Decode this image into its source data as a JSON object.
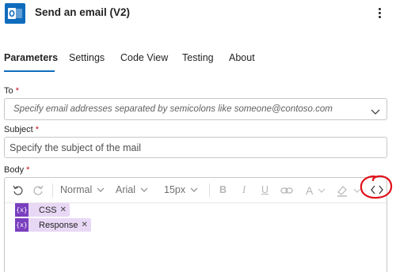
{
  "header": {
    "title": "Send an email (V2)",
    "app_icon": "outlook-icon",
    "more_icon": "more-vertical-icon"
  },
  "tabs": [
    {
      "label": "Parameters",
      "active": true
    },
    {
      "label": "Settings",
      "active": false
    },
    {
      "label": "Code View",
      "active": false
    },
    {
      "label": "Testing",
      "active": false
    },
    {
      "label": "About",
      "active": false
    }
  ],
  "fields": {
    "to": {
      "label": "To",
      "required": "*",
      "placeholder": "Specify email addresses separated by semicolons like someone@contoso.com"
    },
    "subject": {
      "label": "Subject",
      "required": "*",
      "placeholder": "Specify the subject of the mail"
    },
    "body": {
      "label": "Body",
      "required": "*"
    }
  },
  "toolbar": {
    "undo": "undo-icon",
    "redo": "redo-icon",
    "block_format": "Normal",
    "font_family": "Arial",
    "font_size": "15px",
    "bold": "B",
    "italic": "I",
    "underline": "U",
    "link": "link-icon",
    "font_color": "A",
    "highlight": "highlight-icon",
    "code_view": "code-view-icon"
  },
  "tokens": [
    {
      "label": "CSS",
      "icon": "{x}"
    },
    {
      "label": "Response",
      "icon": "{x}"
    }
  ],
  "colors": {
    "accent": "#0f6cbd",
    "required": "#c50f1f",
    "token_bg": "#e8d8f5",
    "token_icon": "#7a3fbf",
    "annotation": "#e0101a"
  }
}
